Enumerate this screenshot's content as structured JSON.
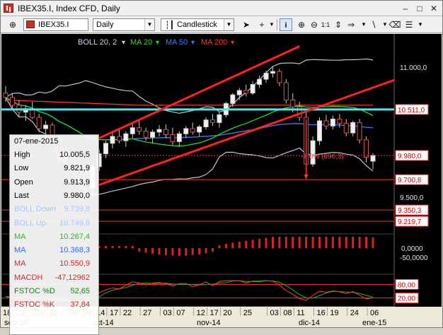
{
  "window": {
    "title": "IBEX35.I, Index CFD, Daily",
    "buttons": [
      "minimize-icon",
      "maximize-icon",
      "close-icon"
    ]
  },
  "toolbar": {
    "symbol": "IBEX35.I",
    "timeframe": "Daily",
    "chart_type": "Candlestick",
    "icons": [
      "crosshair-icon",
      "info-icon",
      "zoom-in-icon",
      "zoom-out-icon",
      "zoom-11-icon",
      "arrow-icon",
      "line-icon",
      "eraser-icon",
      "settings-icon"
    ]
  },
  "chart": {
    "indicators_legend": [
      {
        "label": "BOLL 20, 2",
        "color": "#cfd8e6"
      },
      {
        "label": "MA 20",
        "color": "#22dd22"
      },
      {
        "label": "MA 50",
        "color": "#4477ff"
      },
      {
        "label": "MA 200",
        "color": "#ff3333"
      }
    ],
    "price_labels": [
      {
        "text": "11.000,0",
        "price": 11000,
        "boxed": false
      },
      {
        "text": "10.511,0",
        "price": 10511,
        "boxed": true
      },
      {
        "text": "9.980,0",
        "price": 9980,
        "boxed": true
      },
      {
        "text": "9.700,8",
        "price": 9700.8,
        "boxed": true
      },
      {
        "text": "9.500,0",
        "price": 9500,
        "boxed": false
      },
      {
        "text": "9.350,3",
        "price": 9350.3,
        "boxed": true
      },
      {
        "text": "9.219,7",
        "price": 9219.7,
        "boxed": true
      }
    ],
    "drawdown_label": "-7,0% (696,3)",
    "macd_labels": [
      "0,0000",
      "-50,0000"
    ],
    "stoch_labels": [
      "80,00",
      "20,00"
    ],
    "x_day_labels": [
      "18",
      "23",
      "26",
      "01",
      "06",
      "09",
      "14",
      "17",
      "22",
      "27",
      "03",
      "07",
      "12",
      "17",
      "20",
      "25",
      "03",
      "08",
      "11",
      "16",
      "19",
      "24",
      "06"
    ],
    "x_month_labels": [
      "sep-14",
      "oct-14",
      "nov-14",
      "dic-14",
      "ene-15"
    ]
  },
  "info_panel": {
    "date": "07-ene-2015",
    "rows": [
      {
        "label": "High",
        "value": "10.005,5",
        "color": "#000000"
      },
      {
        "label": "Low",
        "value": "9.821,9",
        "color": "#000000"
      },
      {
        "label": "Open",
        "value": "9.913,9",
        "color": "#000000"
      },
      {
        "label": "Last",
        "value": "9.980,0",
        "color": "#000000"
      },
      {
        "label": "BOLL Down",
        "value": "9.739,8",
        "color": "#9fc6ff"
      },
      {
        "label": "BOLL Up",
        "value": "10.749,9",
        "color": "#9fc6ff"
      },
      {
        "label": "MA",
        "value": "10.267,4",
        "color": "#22bb22"
      },
      {
        "label": "MA",
        "value": "10.368,3",
        "color": "#3366ee"
      },
      {
        "label": "MA",
        "value": "10.550,9",
        "color": "#dd2222"
      },
      {
        "label": "MACDH",
        "value": "-47,12962",
        "color": "#dd2222"
      },
      {
        "label": "FSTOC %D",
        "value": "52,65",
        "color": "#118811"
      },
      {
        "label": "FSTOC %K",
        "value": "37,84",
        "color": "#dd2222"
      }
    ]
  },
  "chart_data": {
    "type": "candlestick",
    "symbol": "IBEX35.I",
    "timeframe": "Daily",
    "ohlc": [
      [
        10700,
        10780,
        10600,
        10650
      ],
      [
        10650,
        10700,
        10520,
        10560
      ],
      [
        10560,
        10620,
        10420,
        10480
      ],
      [
        10480,
        10560,
        10380,
        10520
      ],
      [
        10520,
        10600,
        10400,
        10420
      ],
      [
        10420,
        10460,
        10250,
        10290
      ],
      [
        10290,
        10380,
        10180,
        10330
      ],
      [
        10330,
        10360,
        10120,
        10160
      ],
      [
        10160,
        10220,
        9900,
        9950
      ],
      [
        9950,
        10080,
        9880,
        10020
      ],
      [
        10020,
        10060,
        9820,
        9860
      ],
      [
        9860,
        9950,
        9700,
        9760
      ],
      [
        9760,
        9800,
        9550,
        9600
      ],
      [
        9600,
        9900,
        9480,
        9850
      ],
      [
        9850,
        10050,
        9800,
        10000
      ],
      [
        10000,
        10150,
        9950,
        10120
      ],
      [
        10120,
        10250,
        10060,
        10200
      ],
      [
        10200,
        10300,
        10120,
        10150
      ],
      [
        10150,
        10260,
        10080,
        10230
      ],
      [
        10230,
        10350,
        10180,
        10300
      ],
      [
        10300,
        10380,
        10220,
        10260
      ],
      [
        10260,
        10300,
        10150,
        10190
      ],
      [
        10190,
        10280,
        10120,
        10250
      ],
      [
        10250,
        10330,
        10200,
        10280
      ],
      [
        10280,
        10340,
        10180,
        10220
      ],
      [
        10220,
        10300,
        10100,
        10140
      ],
      [
        10140,
        10260,
        10080,
        10230
      ],
      [
        10230,
        10320,
        10180,
        10290
      ],
      [
        10290,
        10360,
        10220,
        10250
      ],
      [
        10250,
        10330,
        10200,
        10310
      ],
      [
        10310,
        10420,
        10280,
        10390
      ],
      [
        10390,
        10460,
        10320,
        10360
      ],
      [
        10360,
        10480,
        10300,
        10450
      ],
      [
        10450,
        10600,
        10420,
        10580
      ],
      [
        10580,
        10700,
        10540,
        10680
      ],
      [
        10680,
        10760,
        10620,
        10730
      ],
      [
        10730,
        10800,
        10660,
        10700
      ],
      [
        10700,
        10840,
        10680,
        10800
      ],
      [
        10800,
        10900,
        10760,
        10860
      ],
      [
        10860,
        10960,
        10820,
        10930
      ],
      [
        10930,
        11000,
        10880,
        10950
      ],
      [
        10950,
        10980,
        10780,
        10820
      ],
      [
        10820,
        10860,
        10580,
        10620
      ],
      [
        10620,
        10700,
        10480,
        10540
      ],
      [
        10540,
        10600,
        10380,
        10420
      ],
      [
        10420,
        10480,
        9760,
        9880
      ],
      [
        9880,
        10200,
        9850,
        10150
      ],
      [
        10150,
        10420,
        10100,
        10380
      ],
      [
        10380,
        10450,
        10280,
        10320
      ],
      [
        10320,
        10440,
        10280,
        10400
      ],
      [
        10400,
        10460,
        10300,
        10350
      ],
      [
        10350,
        10400,
        10200,
        10240
      ],
      [
        10240,
        10380,
        10200,
        10360
      ],
      [
        10360,
        10400,
        10120,
        10160
      ],
      [
        10160,
        10200,
        9900,
        9960
      ],
      [
        9913.9,
        10005.5,
        9821.9,
        9980
      ]
    ],
    "bollinger": {
      "period": 20,
      "deviations": 2,
      "last_up": 10749.9,
      "last_down": 9739.8
    },
    "moving_averages": [
      {
        "name": "MA 20",
        "last": 10267.4
      },
      {
        "name": "MA 50",
        "last": 10368.3
      },
      {
        "name": "MA 200",
        "last": 10550.9
      }
    ],
    "horizontal_levels": [
      10511.0,
      9980.0,
      9700.8,
      9350.3,
      9219.7
    ],
    "macd_histogram_last": -47.12962,
    "fast_stochastic": {
      "d_last": 52.65,
      "k_last": 37.84,
      "levels": [
        80,
        20
      ]
    },
    "ylim": [
      9180,
      11220
    ]
  }
}
